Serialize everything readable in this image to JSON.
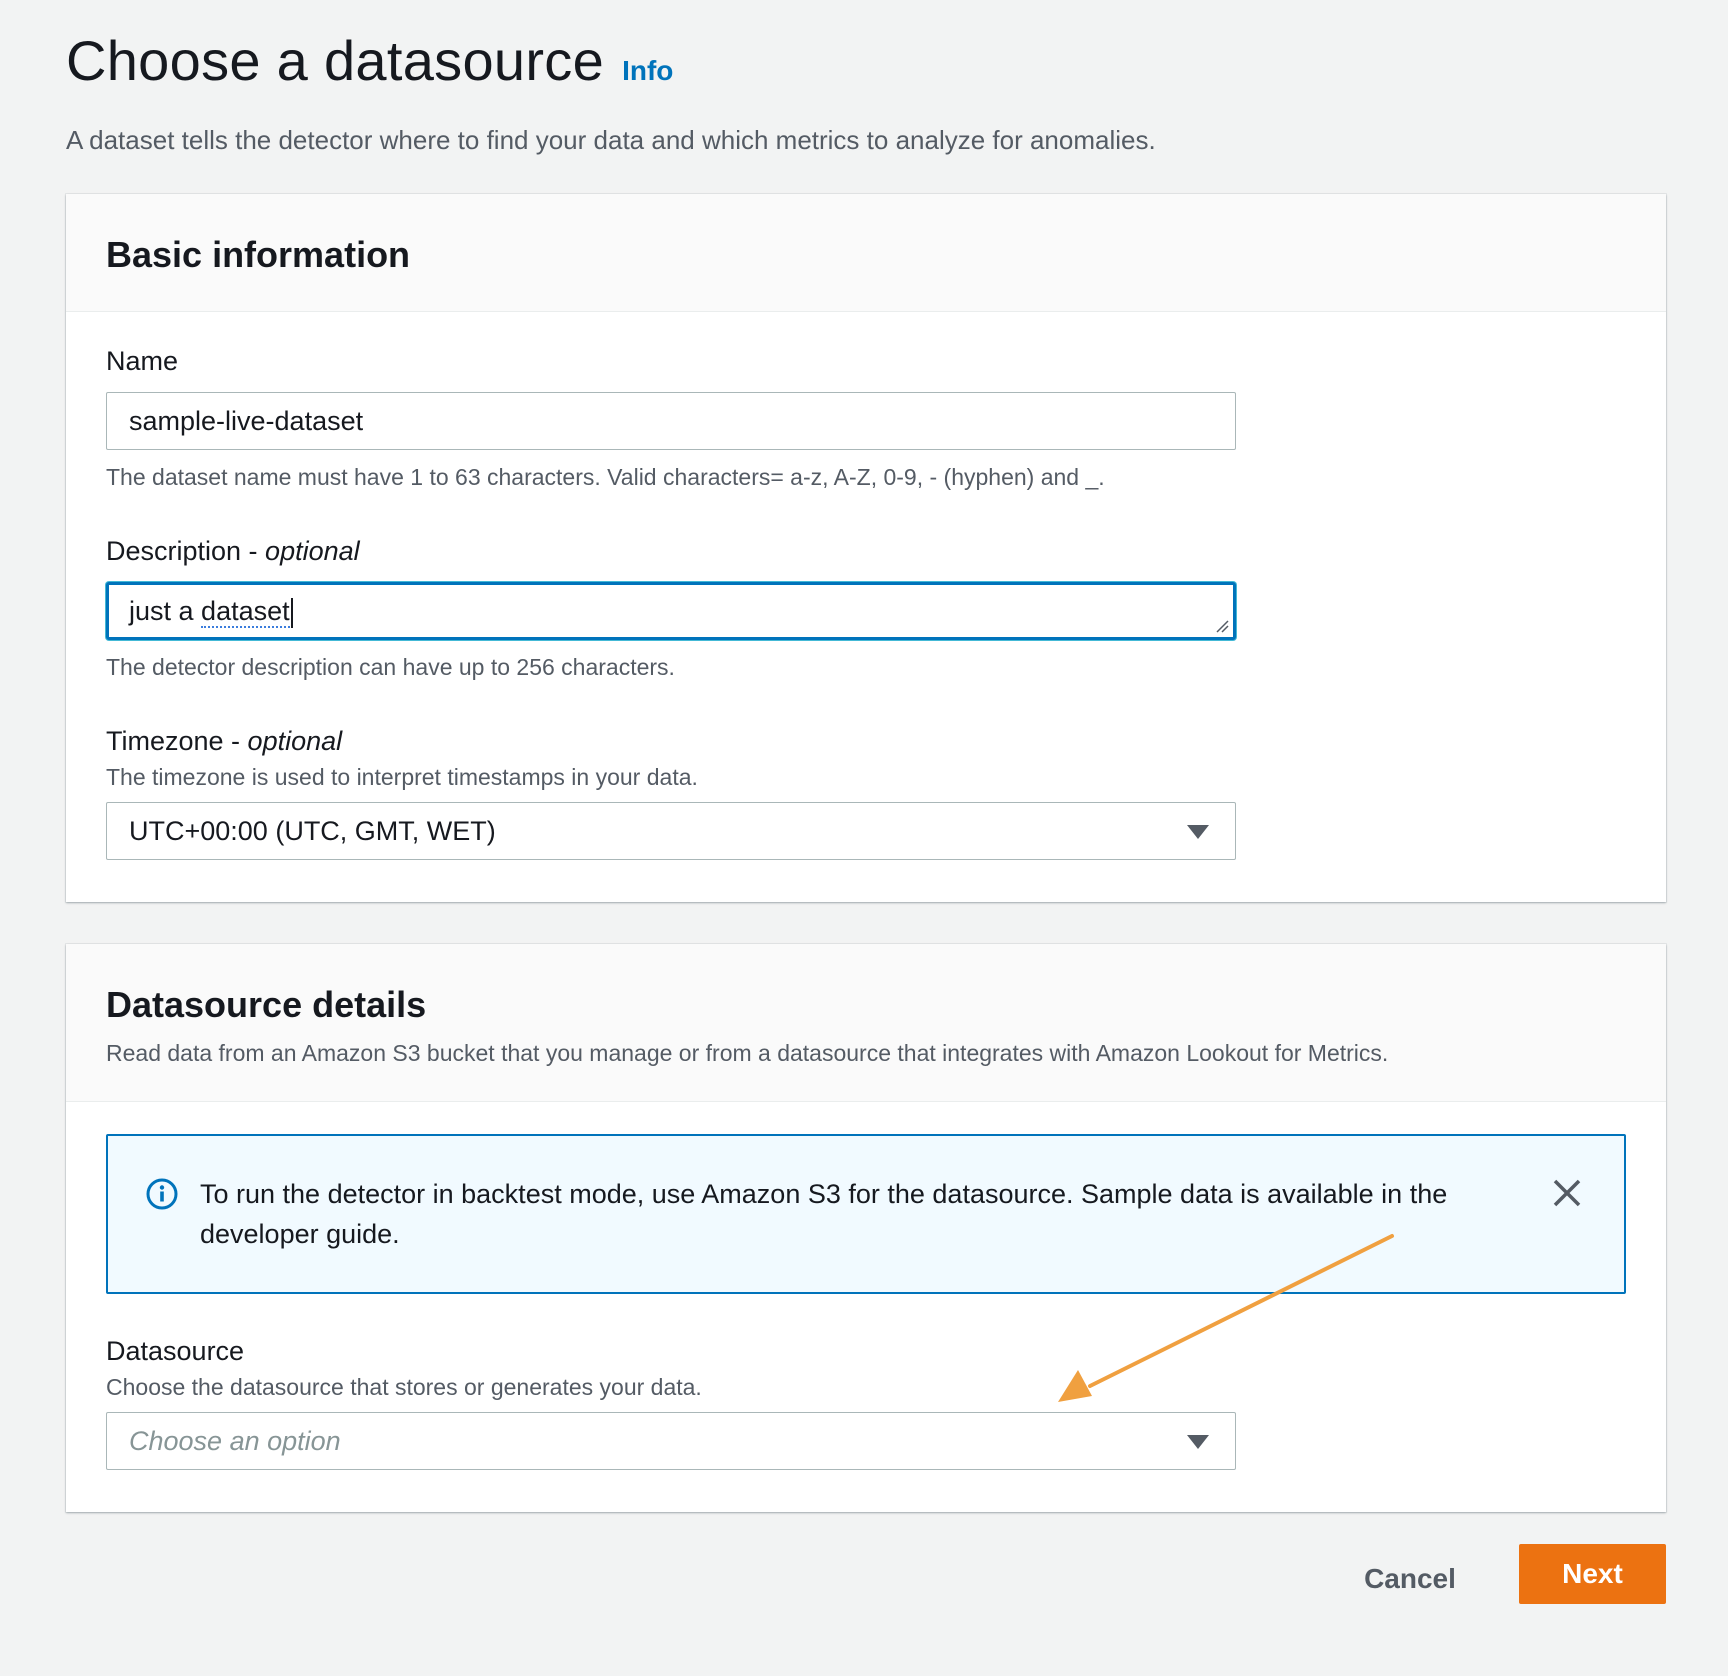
{
  "header": {
    "title": "Choose a datasource",
    "info_link": "Info",
    "description": "A dataset tells the detector where to find your data and which metrics to analyze for anomalies."
  },
  "basic_info": {
    "title": "Basic information",
    "name": {
      "label": "Name",
      "value": "sample-live-dataset",
      "constraint": "The dataset name must have 1 to 63 characters. Valid characters= a-z, A-Z, 0-9, - (hyphen) and _."
    },
    "description": {
      "label": "Description - ",
      "optional": "optional",
      "value_prefix": "just a ",
      "value_misspelled": "dataset",
      "constraint": "The detector description can have up to 256 characters."
    },
    "timezone": {
      "label": "Timezone - ",
      "optional": "optional",
      "help": "The timezone is used to interpret timestamps in your data.",
      "selected": "UTC+00:00 (UTC, GMT, WET)"
    }
  },
  "datasource_details": {
    "title": "Datasource details",
    "subtitle": "Read data from an Amazon S3 bucket that you manage or from a datasource that integrates with Amazon Lookout for Metrics.",
    "alert": {
      "text": "To run the detector in backtest mode, use Amazon S3 for the datasource. Sample data is available in the developer guide."
    },
    "datasource": {
      "label": "Datasource",
      "help": "Choose the datasource that stores or generates your data.",
      "placeholder": "Choose an option"
    }
  },
  "footer": {
    "cancel_label": "Cancel",
    "next_label": "Next"
  },
  "colors": {
    "accent": "#0073bb",
    "primary_button": "#ec7211",
    "annotation_arrow": "#f0a040"
  },
  "icons": [
    "info-icon",
    "close-icon",
    "caret-down-icon",
    "resize-grip-icon",
    "annotation-arrow"
  ]
}
